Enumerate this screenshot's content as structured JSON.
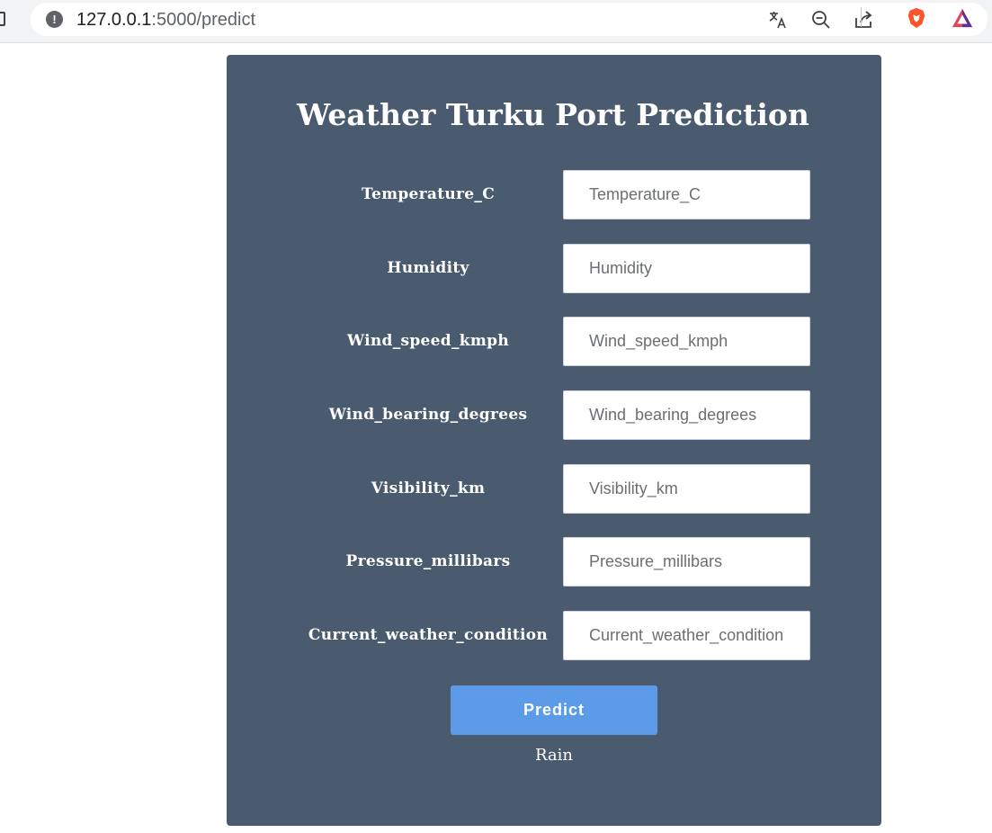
{
  "browser": {
    "url_host": "127.0.0.1",
    "url_path": ":5000/predict",
    "icons": [
      "info-icon",
      "translate-icon",
      "zoom-out-icon",
      "share-icon",
      "brave-shield-icon",
      "brave-rewards-icon"
    ]
  },
  "page": {
    "title": "Weather Turku Port Prediction",
    "fields": [
      {
        "label": "Temperature_C",
        "placeholder": "Temperature_C"
      },
      {
        "label": "Humidity",
        "placeholder": "Humidity"
      },
      {
        "label": "Wind_speed_kmph",
        "placeholder": "Wind_speed_kmph"
      },
      {
        "label": "Wind_bearing_degrees",
        "placeholder": "Wind_bearing_degrees"
      },
      {
        "label": "Visibility_km",
        "placeholder": "Visibility_km"
      },
      {
        "label": "Pressure_millibars",
        "placeholder": "Pressure_millibars"
      },
      {
        "label": "Current_weather_condition",
        "placeholder": "Current_weather_condition"
      }
    ],
    "predict_label": "Predict",
    "result": "Rain"
  },
  "colors": {
    "card_bg": "#4a5b70",
    "button_bg": "#5b9be8",
    "brave_orange": "#fb542b"
  }
}
